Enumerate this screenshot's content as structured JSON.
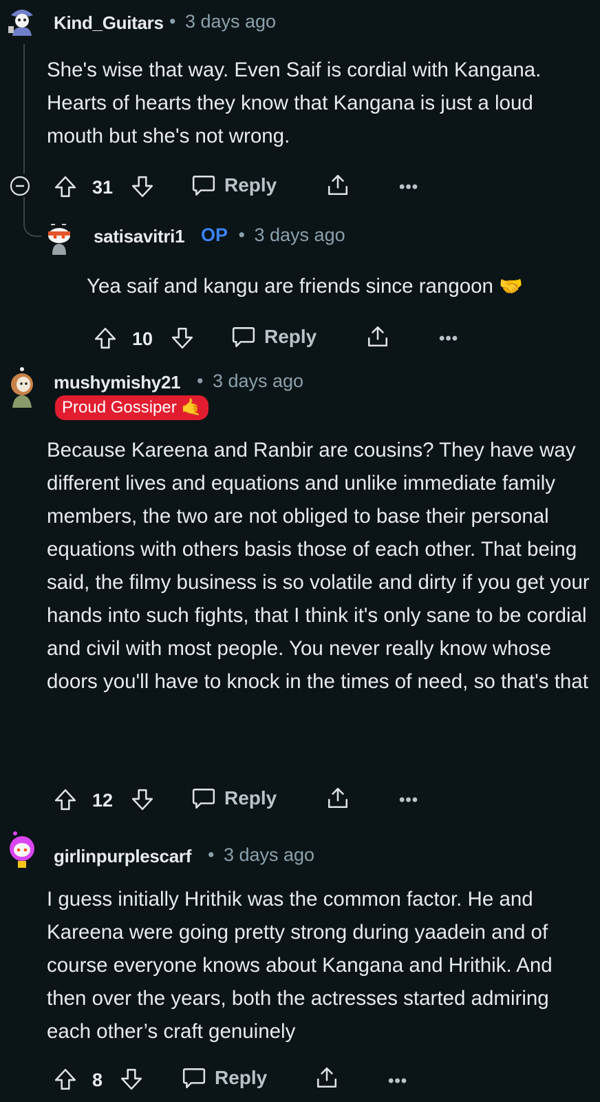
{
  "comments": [
    {
      "username": "Kind_Guitars",
      "time": "3 days ago",
      "text": "She's wise that way. Even Saif is cordial with Kangana. Hearts of hearts they know that Kangana is just a loud mouth but she's not wrong.",
      "votes": "31",
      "reply_label": "Reply",
      "more_label": "•••"
    },
    {
      "username": "satisavitri1",
      "op_badge": "OP",
      "time": "3 days ago",
      "text": "Yea saif and kangu are friends since rangoon",
      "emoji": "🤝",
      "votes": "10",
      "reply_label": "Reply",
      "more_label": "•••"
    },
    {
      "username": "mushymishy21",
      "time": "3 days ago",
      "flair": "Proud Gossiper",
      "flair_emoji": "🤙",
      "text": "Because Kareena and Ranbir are cousins? They have way different lives and equations and unlike immediate family members, the two are not obliged to base their personal equations with others basis those of each other. That being said, the filmy business is so volatile and dirty if you get your hands into such fights, that I think it's only sane to be cordial and civil with most people. You never really know whose doors you'll have to knock in the times of need, so that's that",
      "votes": "12",
      "reply_label": "Reply",
      "more_label": "•••"
    },
    {
      "username": "girlinpurplescarf",
      "time": "3 days ago",
      "text": "I guess initially Hrithik was the common factor. He and Kareena were going pretty strong during yaadein and of course everyone knows about Kangana and Hrithik. And then over the years, both the actresses started admiring each other’s craft genuinely",
      "votes": "8",
      "reply_label": "Reply",
      "more_label": "•••"
    }
  ],
  "separator": "•",
  "colors": {
    "background": "#0b1416",
    "op_badge": "#3b82f6",
    "flair_bg": "#e11d2f",
    "meta_text": "#8ba2ad"
  },
  "icons": [
    "collapse-icon",
    "upvote-icon",
    "downvote-icon",
    "comment-icon",
    "share-icon",
    "more-icon"
  ]
}
